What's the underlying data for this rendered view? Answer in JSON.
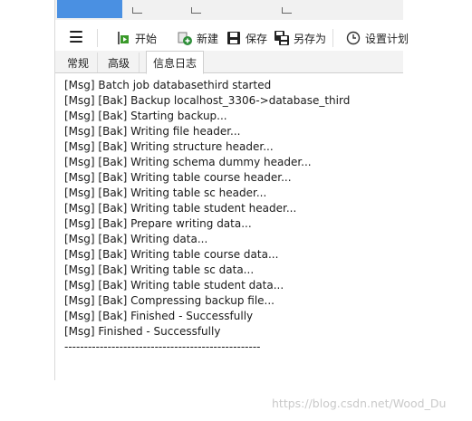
{
  "toolbar": {
    "menu_icon": "hamburger-icon",
    "start_label": "开始",
    "new_label": "新建",
    "save_label": "保存",
    "save_as_label": "另存为",
    "schedule_label": "设置计划"
  },
  "tabs": [
    {
      "label": "常规"
    },
    {
      "label": "高级"
    },
    {
      "label": "信息日志"
    }
  ],
  "log": {
    "lines": [
      "[Msg] Batch job databasethird started",
      "[Msg] [Bak] Backup localhost_3306->database_third",
      "[Msg] [Bak] Starting backup...",
      "[Msg] [Bak] Writing file header...",
      "[Msg] [Bak] Writing structure header...",
      "[Msg] [Bak] Writing schema dummy header...",
      "[Msg] [Bak] Writing table course header...",
      "[Msg] [Bak] Writing table sc header...",
      "[Msg] [Bak] Writing table student header...",
      "[Msg] [Bak] Prepare writing data...",
      "[Msg] [Bak] Writing data...",
      "[Msg] [Bak] Writing table course data...",
      "[Msg] [Bak] Writing table sc data...",
      "[Msg] [Bak] Writing table student data...",
      "[Msg] [Bak] Compressing backup file...",
      "[Msg] [Bak] Finished - Successfully",
      "[Msg] Finished - Successfully",
      "--------------------------------------------------"
    ]
  },
  "watermark": "https://blog.csdn.net/Wood_Du",
  "colors": {
    "accent": "#4a90e2",
    "start_green": "#3a9a2a",
    "new_green": "#2f8f3a"
  }
}
